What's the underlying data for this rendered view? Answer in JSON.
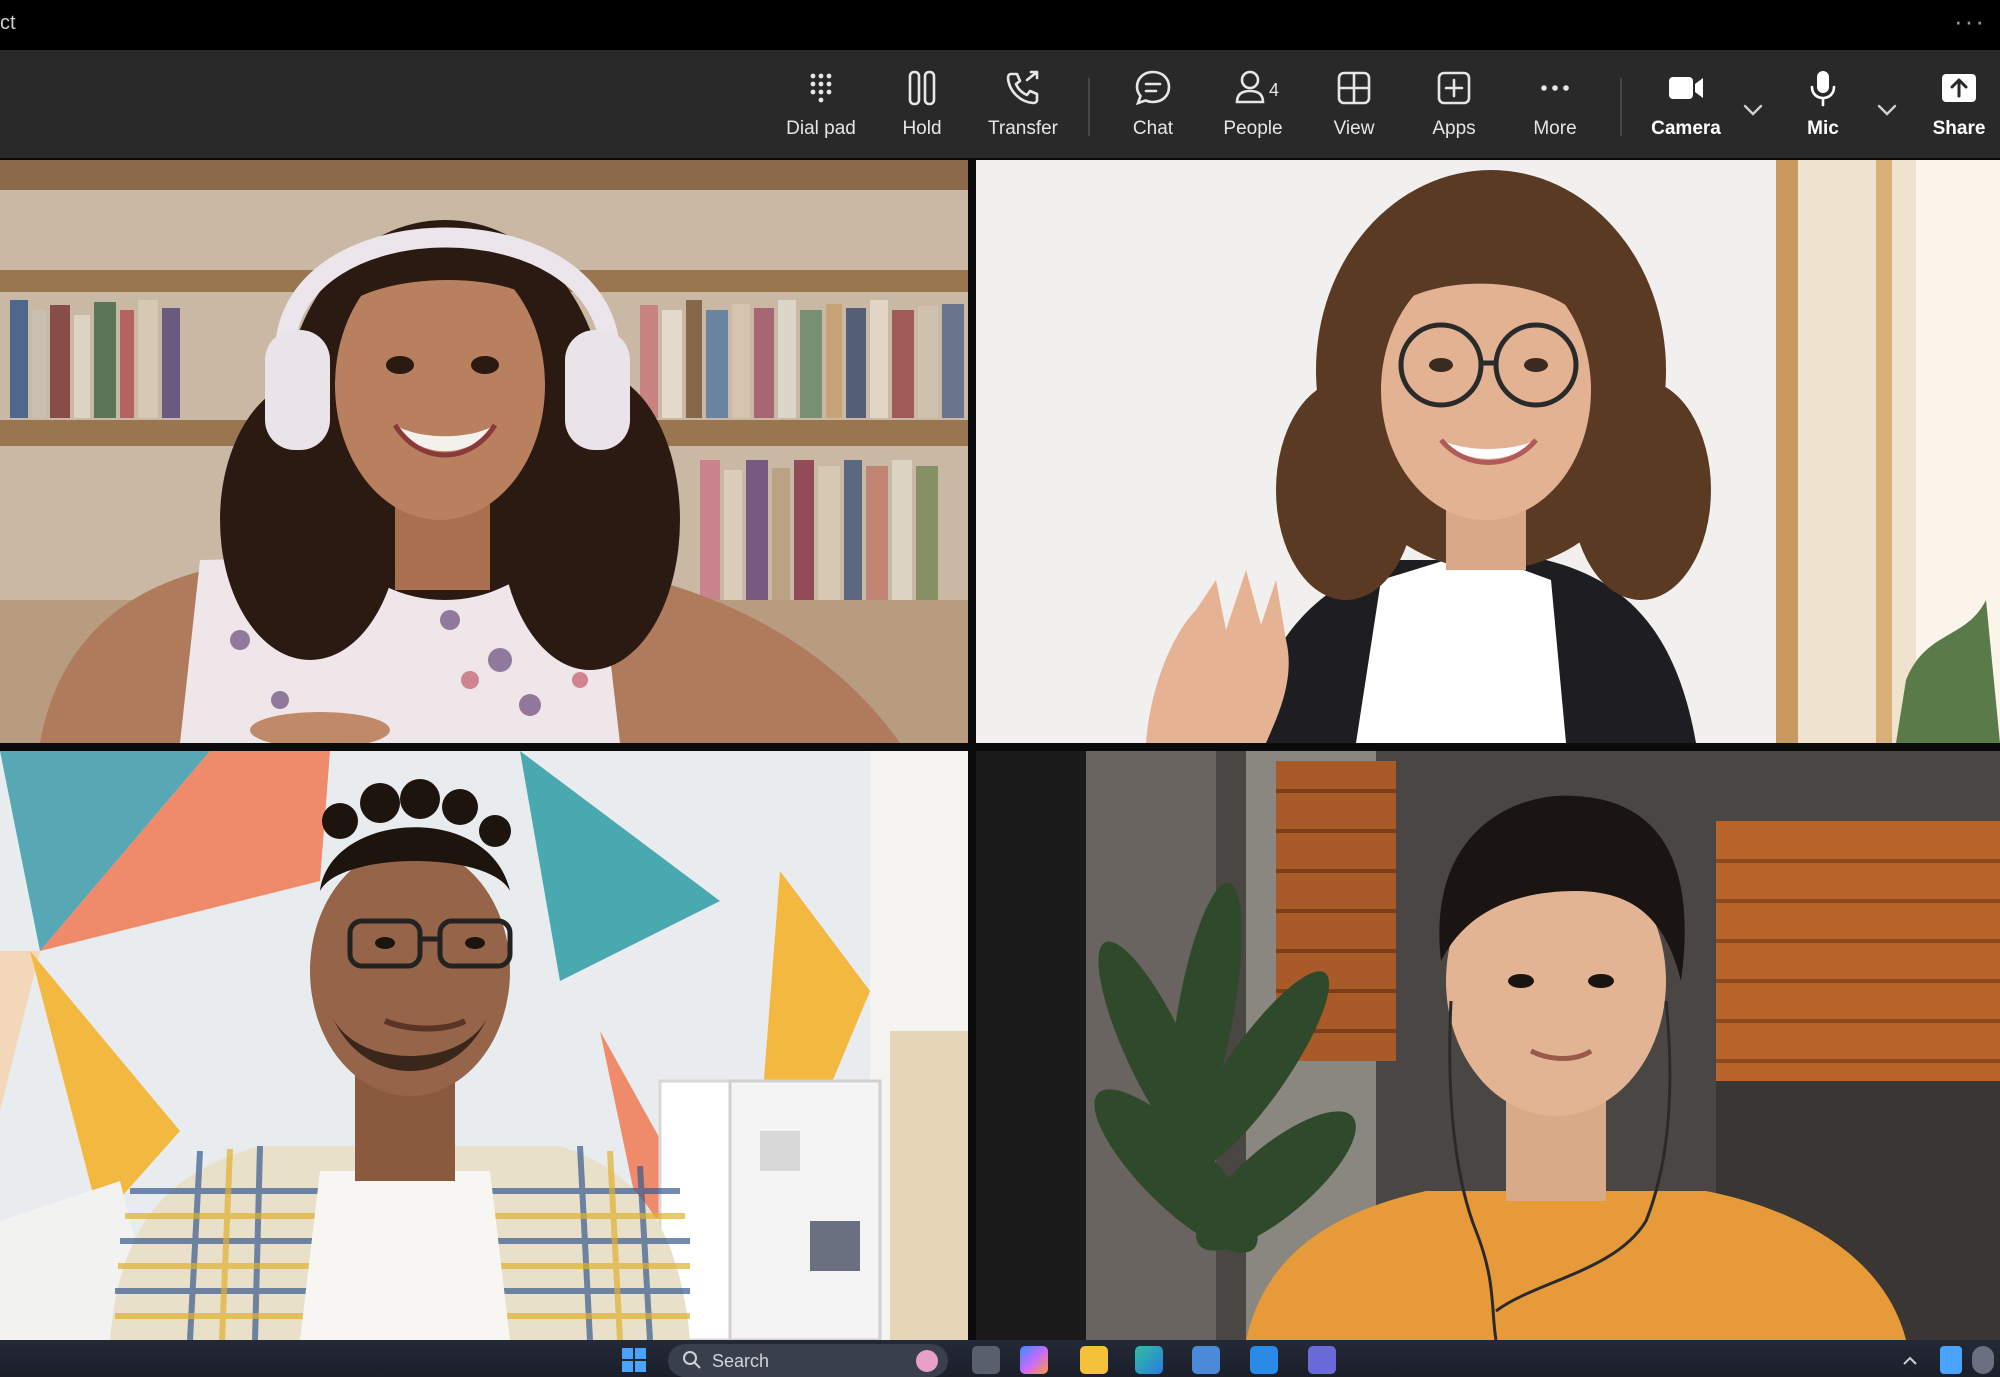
{
  "window": {
    "title": "ct",
    "menu_dots": "···"
  },
  "toolbar": {
    "items": [
      {
        "id": "dialpad",
        "label": "Dial pad",
        "icon": "dialpad-icon"
      },
      {
        "id": "hold",
        "label": "Hold",
        "icon": "pause-icon"
      },
      {
        "id": "transfer",
        "label": "Transfer",
        "icon": "phone-transfer-icon"
      },
      {
        "id": "chat",
        "label": "Chat",
        "icon": "chat-icon"
      },
      {
        "id": "people",
        "label": "People",
        "icon": "people-icon",
        "count": "4"
      },
      {
        "id": "view",
        "label": "View",
        "icon": "grid-view-icon"
      },
      {
        "id": "apps",
        "label": "Apps",
        "icon": "add-app-icon"
      },
      {
        "id": "more",
        "label": "More",
        "icon": "more-icon"
      },
      {
        "id": "camera",
        "label": "Camera",
        "icon": "camera-icon"
      },
      {
        "id": "mic",
        "label": "Mic",
        "icon": "microphone-icon"
      },
      {
        "id": "share",
        "label": "Share",
        "icon": "share-screen-icon"
      }
    ]
  },
  "participants": [
    {
      "id": "p1",
      "description": "woman with headphones"
    },
    {
      "id": "p2",
      "description": "woman with glasses"
    },
    {
      "id": "p3",
      "description": "man with glasses"
    },
    {
      "id": "p4",
      "description": "man with earphones"
    }
  ],
  "taskbar": {
    "search_placeholder": "Search",
    "colors": {
      "accent": "#4aa3ff",
      "toolbar_bg": "#292929"
    }
  }
}
